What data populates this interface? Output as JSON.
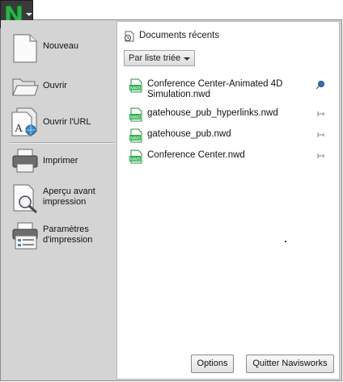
{
  "app": {
    "logo": "navisworks-logo-icon"
  },
  "menu": {
    "items": [
      {
        "label": "Nouveau",
        "icon": "blank-document-icon"
      },
      {
        "label": "Ouvrir",
        "icon": "open-folder-icon"
      },
      {
        "label": "Ouvrir l'URL",
        "icon": "open-url-icon"
      },
      {
        "label": "Imprimer",
        "icon": "printer-icon"
      },
      {
        "label": "Aperçu avant impression",
        "icon": "print-preview-icon"
      },
      {
        "label": "Paramètres d'impression",
        "icon": "print-settings-icon"
      }
    ]
  },
  "recent": {
    "title": "Documents récents",
    "sort_label": "Par liste triée",
    "files": [
      {
        "name": "Conference Center-Animated 4D Simulation.nwd",
        "pinned": true
      },
      {
        "name": "gatehouse_pub_hyperlinks.nwd",
        "pinned": false
      },
      {
        "name": "gatehouse_pub.nwd",
        "pinned": false
      },
      {
        "name": "Conference Center.nwd",
        "pinned": false
      }
    ],
    "file_badge": "NWD"
  },
  "footer": {
    "options_label": "Options",
    "quit_label": "Quitter Navisworks"
  },
  "colors": {
    "logo_green": "#2bb24c",
    "panel_gray": "#d4d4d4"
  }
}
